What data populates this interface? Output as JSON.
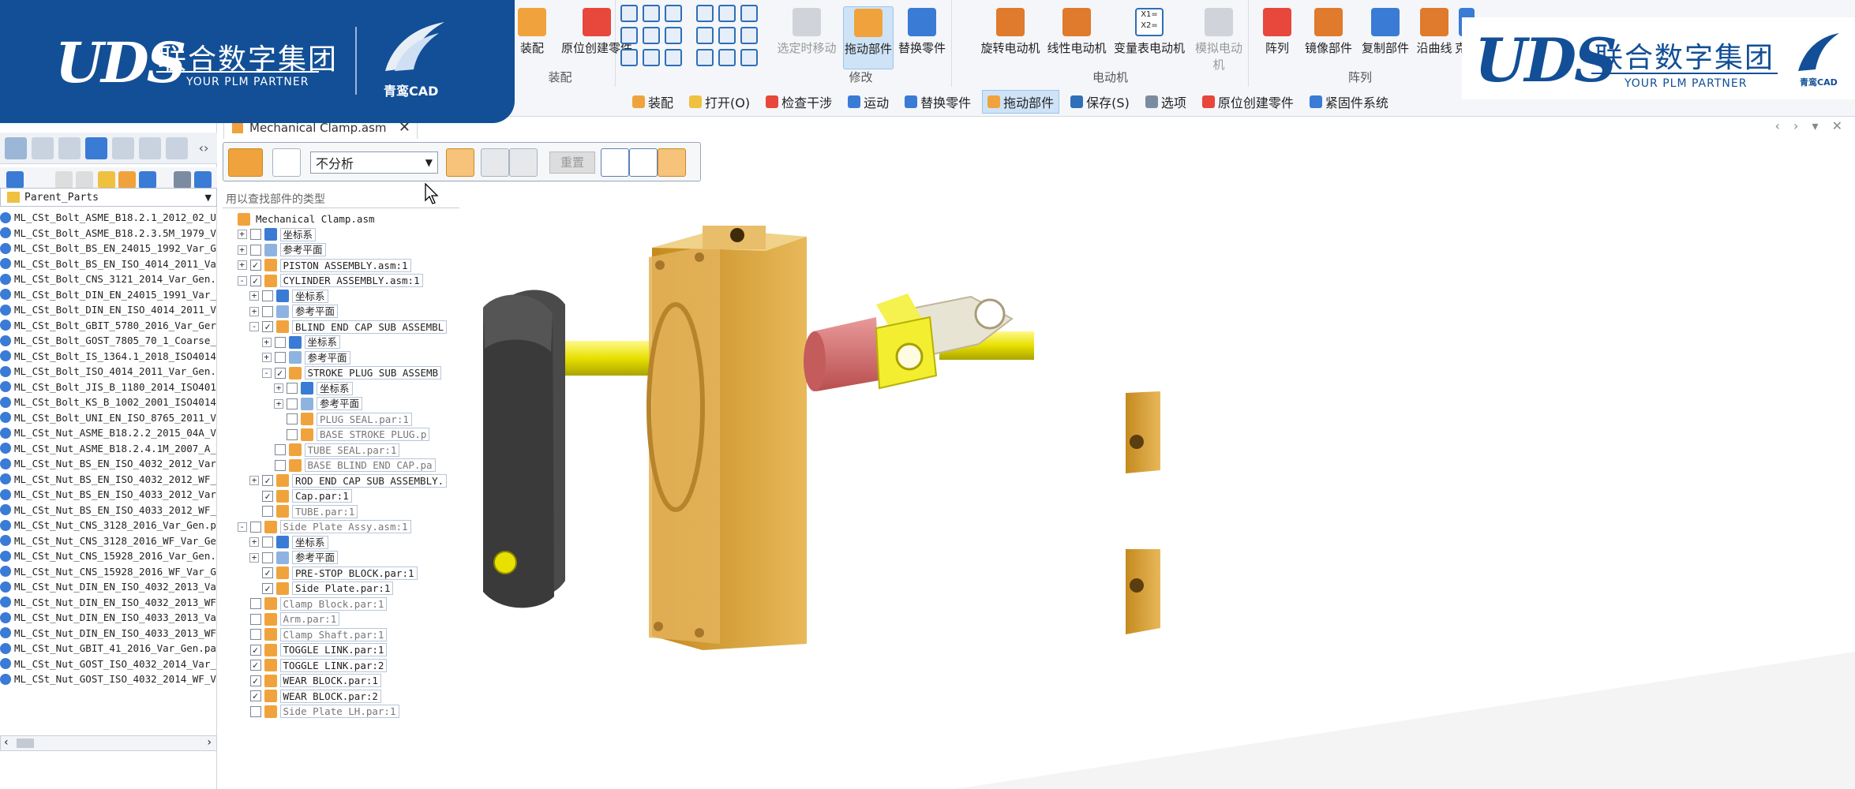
{
  "banner": {
    "left": {
      "uds": "UDS",
      "cn": "联合数字集团",
      "en": "YOUR PLM PARTNER",
      "sub_brand": "青鸾CAD"
    },
    "right": {
      "uds": "UDS",
      "cn": "联合数字集团",
      "en": "YOUR PLM PARTNER",
      "sub_brand": "青鸾CAD"
    }
  },
  "ribbon": {
    "buttons": {
      "assembly_partial": "装配",
      "in_place_create": "原位创建零件",
      "sel_move": "选定时移动",
      "drag_part": "拖动部件",
      "replace_part": "替换零件",
      "rot_motor": "旋转电动机",
      "lin_motor": "线性电动机",
      "var_motor": "变量表电动机",
      "sim_motor": "模拟电动机",
      "array": "阵列",
      "mirror": "镜像部件",
      "copy": "复制部件",
      "along_curve": "沿曲线",
      "clone": "克隆"
    },
    "groups": {
      "assembly": "装配",
      "modify": "修改",
      "motor": "电动机",
      "pattern": "阵列"
    },
    "var_icon_text": "X1=\nX2="
  },
  "cmdbar": [
    "装配",
    "打开(O)",
    "检查干涉",
    "运动",
    "替换零件",
    "拖动部件",
    "保存(S)",
    "选项",
    "原位创建零件",
    "紧固件系统"
  ],
  "doc_tab": {
    "title": "Mechanical Clamp.asm",
    "close": "✕"
  },
  "pf_toolbar": {
    "analysis": "不分析",
    "reset": "重置"
  },
  "tree_search_placeholder": "用以查找部件的类型",
  "library": {
    "folder": "Parent_Parts",
    "items": [
      "ML_CSt_Bolt_ASME_B18.2.1_2012_02_U",
      "ML_CSt_Bolt_ASME_B18.2.3.5M_1979_V",
      "ML_CSt_Bolt_BS_EN_24015_1992_Var_G",
      "ML_CSt_Bolt_BS_EN_ISO_4014_2011_Va",
      "ML_CSt_Bolt_CNS_3121_2014_Var_Gen.",
      "ML_CSt_Bolt_DIN_EN_24015_1991_Var_",
      "ML_CSt_Bolt_DIN_EN_ISO_4014_2011_V",
      "ML_CSt_Bolt_GBIT_5780_2016_Var_Ger",
      "ML_CSt_Bolt_GOST_7805_70_1_Coarse_",
      "ML_CSt_Bolt_IS_1364.1_2018_ISO4014",
      "ML_CSt_Bolt_ISO_4014_2011_Var_Gen.",
      "ML_CSt_Bolt_JIS_B_1180_2014_ISO401",
      "ML_CSt_Bolt_KS_B_1002_2001_ISO4014",
      "ML_CSt_Bolt_UNI_EN_ISO_8765_2011_V",
      "ML_CSt_Nut_ASME_B18.2.2_2015_04A_V",
      "ML_CSt_Nut_ASME_B18.2.4.1M_2007_A_",
      "ML_CSt_Nut_BS_EN_ISO_4032_2012_Var",
      "ML_CSt_Nut_BS_EN_ISO_4032_2012_WF_",
      "ML_CSt_Nut_BS_EN_ISO_4033_2012_Var",
      "ML_CSt_Nut_BS_EN_ISO_4033_2012_WF_",
      "ML_CSt_Nut_CNS_3128_2016_Var_Gen.p",
      "ML_CSt_Nut_CNS_3128_2016_WF_Var_Ge",
      "ML_CSt_Nut_CNS_15928_2016_Var_Gen.",
      "ML_CSt_Nut_CNS_15928_2016_WF_Var_G",
      "ML_CSt_Nut_DIN_EN_ISO_4032_2013_Va",
      "ML_CSt_Nut_DIN_EN_ISO_4032_2013_WF",
      "ML_CSt_Nut_DIN_EN_ISO_4033_2013_Va",
      "ML_CSt_Nut_DIN_EN_ISO_4033_2013_WF",
      "ML_CSt_Nut_GBIT_41_2016_Var_Gen.pa",
      "ML_CSt_Nut_GOST_ISO_4032_2014_Var_",
      "ML_CSt_Nut_GOST_ISO_4032_2014_WF_V"
    ]
  },
  "tree": [
    {
      "label": "Mechanical Clamp.asm",
      "level": 0,
      "exp": "",
      "chk": "none",
      "icon": "asm",
      "dim": false
    },
    {
      "label": "坐标系",
      "level": 1,
      "exp": "+",
      "chk": "off",
      "icon": "csys",
      "dim": false
    },
    {
      "label": "参考平面",
      "level": 1,
      "exp": "+",
      "chk": "off",
      "icon": "plane",
      "dim": false
    },
    {
      "label": "PISTON ASSEMBLY.asm:1",
      "level": 1,
      "exp": "+",
      "chk": "on",
      "icon": "asm",
      "dim": false
    },
    {
      "label": "CYLINDER ASSEMBLY.asm:1",
      "level": 1,
      "exp": "-",
      "chk": "on",
      "icon": "asm",
      "dim": false
    },
    {
      "label": "坐标系",
      "level": 2,
      "exp": "+",
      "chk": "off",
      "icon": "csys",
      "dim": false
    },
    {
      "label": "参考平面",
      "level": 2,
      "exp": "+",
      "chk": "off",
      "icon": "plane",
      "dim": false
    },
    {
      "label": "BLIND END CAP SUB ASSEMBL",
      "level": 2,
      "exp": "-",
      "chk": "on",
      "icon": "asm",
      "dim": false
    },
    {
      "label": "坐标系",
      "level": 3,
      "exp": "+",
      "chk": "off",
      "icon": "csys",
      "dim": false
    },
    {
      "label": "参考平面",
      "level": 3,
      "exp": "+",
      "chk": "off",
      "icon": "plane",
      "dim": false
    },
    {
      "label": "STROKE PLUG SUB ASSEMB",
      "level": 3,
      "exp": "-",
      "chk": "on",
      "icon": "asm",
      "dim": false
    },
    {
      "label": "坐标系",
      "level": 4,
      "exp": "+",
      "chk": "off",
      "icon": "csys",
      "dim": false
    },
    {
      "label": "参考平面",
      "level": 4,
      "exp": "+",
      "chk": "off",
      "icon": "plane",
      "dim": false
    },
    {
      "label": "PLUG SEAL.par:1",
      "level": 4,
      "exp": "",
      "chk": "off",
      "icon": "par",
      "dim": true
    },
    {
      "label": "BASE STROKE PLUG.p",
      "level": 4,
      "exp": "",
      "chk": "off",
      "icon": "par",
      "dim": true
    },
    {
      "label": "TUBE SEAL.par:1",
      "level": 3,
      "exp": "",
      "chk": "off",
      "icon": "par",
      "dim": true
    },
    {
      "label": "BASE BLIND END CAP.pa",
      "level": 3,
      "exp": "",
      "chk": "off",
      "icon": "par",
      "dim": true
    },
    {
      "label": "ROD END CAP SUB ASSEMBLY.",
      "level": 2,
      "exp": "+",
      "chk": "on",
      "icon": "asm",
      "dim": false
    },
    {
      "label": "Cap.par:1",
      "level": 2,
      "exp": "",
      "chk": "on",
      "icon": "par",
      "dim": false
    },
    {
      "label": "TUBE.par:1",
      "level": 2,
      "exp": "",
      "chk": "off",
      "icon": "par",
      "dim": true
    },
    {
      "label": "Side Plate Assy.asm:1",
      "level": 1,
      "exp": "-",
      "chk": "off",
      "icon": "asm",
      "dim": true
    },
    {
      "label": "坐标系",
      "level": 2,
      "exp": "+",
      "chk": "off",
      "icon": "csys",
      "dim": false
    },
    {
      "label": "参考平面",
      "level": 2,
      "exp": "+",
      "chk": "off",
      "icon": "plane",
      "dim": false
    },
    {
      "label": "PRE-STOP BLOCK.par:1",
      "level": 2,
      "exp": "",
      "chk": "on",
      "icon": "par",
      "dim": false
    },
    {
      "label": "Side Plate.par:1",
      "level": 2,
      "exp": "",
      "chk": "on",
      "icon": "par",
      "dim": false
    },
    {
      "label": "Clamp Block.par:1",
      "level": 1,
      "exp": "",
      "chk": "off",
      "icon": "par",
      "dim": true
    },
    {
      "label": "Arm.par:1",
      "level": 1,
      "exp": "",
      "chk": "off",
      "icon": "par",
      "dim": true
    },
    {
      "label": "Clamp Shaft.par:1",
      "level": 1,
      "exp": "",
      "chk": "off",
      "icon": "par",
      "dim": true
    },
    {
      "label": "TOGGLE LINK.par:1",
      "level": 1,
      "exp": "",
      "chk": "on",
      "icon": "par",
      "dim": false
    },
    {
      "label": "TOGGLE LINK.par:2",
      "level": 1,
      "exp": "",
      "chk": "on",
      "icon": "par",
      "dim": false
    },
    {
      "label": "WEAR BLOCK.par:1",
      "level": 1,
      "exp": "",
      "chk": "on",
      "icon": "par",
      "dim": false
    },
    {
      "label": "WEAR BLOCK.par:2",
      "level": 1,
      "exp": "",
      "chk": "on",
      "icon": "par",
      "dim": false
    },
    {
      "label": "Side Plate LH.par:1",
      "level": 1,
      "exp": "",
      "chk": "off",
      "icon": "par",
      "dim": true
    }
  ],
  "colors": {
    "banner": "#124f96",
    "gold": "#d9a53b",
    "yellow": "#e8e000",
    "red": "#d06060",
    "dark": "#3a3a3a"
  }
}
